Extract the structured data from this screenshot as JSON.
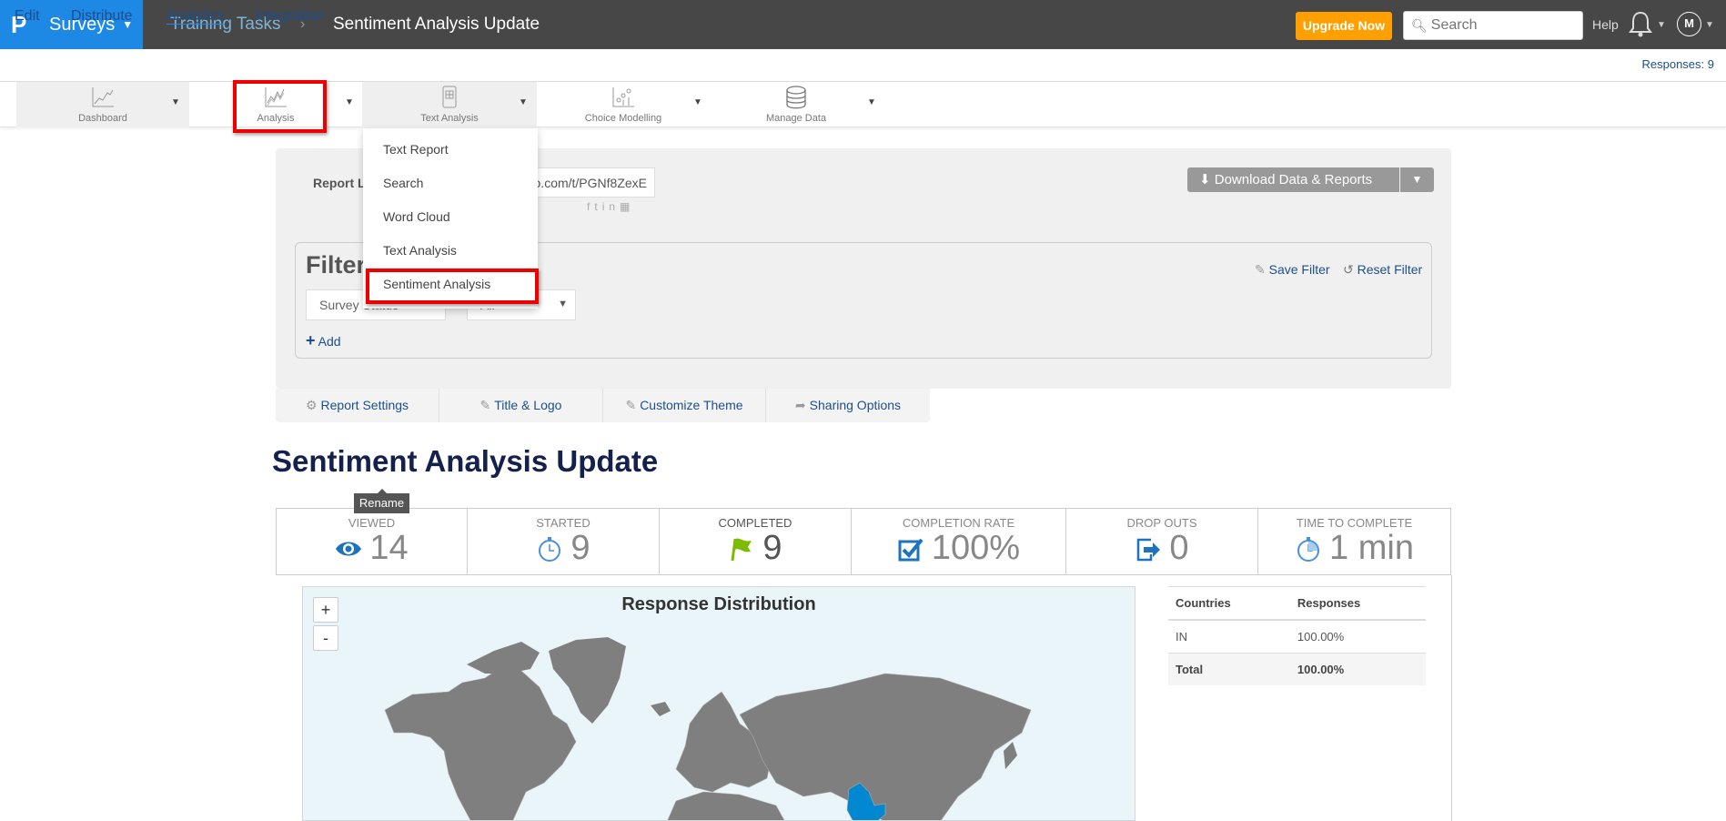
{
  "topbar": {
    "logo": "P",
    "product": "Surveys",
    "breadcrumb": [
      "Training Tasks",
      "Sentiment Analysis Update"
    ],
    "upgrade_label": "Upgrade Now",
    "search_placeholder": "Search",
    "help_label": "Help",
    "avatar_initial": "M"
  },
  "nav": {
    "items": [
      "Edit",
      "Distribute",
      "Analytics",
      "Integration"
    ],
    "active": "Analytics",
    "responses": "Responses: 9"
  },
  "toolbar": {
    "items": [
      {
        "label": "Dashboard",
        "icon": "line-chart-icon"
      },
      {
        "label": "Analysis",
        "icon": "analysis-chart-icon",
        "highlighted": true
      },
      {
        "label": "Text Analysis",
        "icon": "document-icon"
      },
      {
        "label": "Choice Modelling",
        "icon": "scatter-chart-icon"
      },
      {
        "label": "Manage Data",
        "icon": "database-icon"
      }
    ]
  },
  "dropdown": {
    "items": [
      "Text Report",
      "Search",
      "Word Cloud",
      "Text Analysis",
      "Sentiment Analysis"
    ],
    "highlighted": "Sentiment Analysis"
  },
  "report": {
    "link_label": "Report Link",
    "link_value": "o.com/t/PGNf8ZexE",
    "download_label": "Download Data & Reports"
  },
  "filter": {
    "title": "Filter",
    "save_label": "Save Filter",
    "reset_label": "Reset Filter",
    "field_select": "Survey Status",
    "value_select": "All",
    "add_label": "Add"
  },
  "tabs": [
    "Report Settings",
    "Title & Logo",
    "Customize Theme",
    "Sharing Options"
  ],
  "page_title": "Sentiment Analysis Update",
  "tooltip": "Rename",
  "stats": [
    {
      "label": "VIEWED",
      "value": "14",
      "icon": "eye-icon",
      "color": "#1e73be"
    },
    {
      "label": "STARTED",
      "value": "9",
      "icon": "stopwatch-icon",
      "color": "#4a90d9"
    },
    {
      "label": "COMPLETED",
      "value": "9",
      "icon": "flag-icon",
      "color": "#7cbb00"
    },
    {
      "label": "COMPLETION RATE",
      "value": "100%",
      "icon": "checkbox-icon",
      "color": "#1e73be"
    },
    {
      "label": "DROP OUTS",
      "value": "0",
      "icon": "exit-icon",
      "color": "#1e73be"
    },
    {
      "label": "TIME TO COMPLETE",
      "value": "1 min",
      "icon": "stopwatch-icon",
      "color": "#4a90d9"
    }
  ],
  "map": {
    "title": "Response Distribution",
    "zoom_in": "+",
    "zoom_out": "-",
    "highlighted_country": "IN",
    "highlight_color": "#0288d1",
    "land_color": "#7f7f7f"
  },
  "country_table": {
    "headers": [
      "Countries",
      "Responses"
    ],
    "rows": [
      [
        "IN",
        "100.00%"
      ]
    ],
    "total": [
      "Total",
      "100.00%"
    ]
  },
  "colors": {
    "brand_blue": "#1e88e5",
    "topbar": "#474747",
    "upgrade": "#ff9f00",
    "link": "#1b4f8c",
    "highlight_box": "#ee0000"
  }
}
